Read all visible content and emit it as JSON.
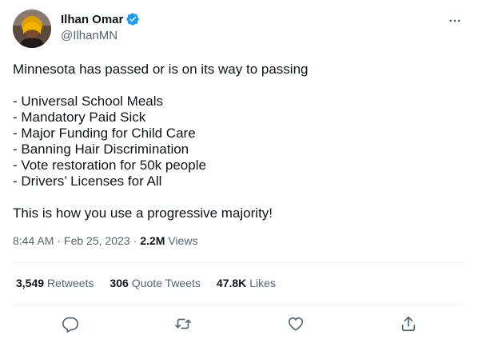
{
  "author": {
    "display_name": "Ilhan Omar",
    "handle": "@IlhanMN",
    "verified": true
  },
  "tweet": {
    "lines": [
      "Minnesota has passed or is on its way to passing",
      "",
      "- Universal School Meals",
      "- Mandatory Paid Sick",
      "- Major Funding for Child Care",
      "- Banning Hair Discrimination",
      "- Vote restoration for 50k people",
      "- Drivers’ Licenses for All",
      "",
      "This is how you use a progressive majority!"
    ],
    "time": "8:44 AM",
    "separator": "·",
    "date": "Feb 25, 2023",
    "views_count": "2.2M",
    "views_label": "Views"
  },
  "stats": {
    "retweets_count": "3,549",
    "retweets_label": "Retweets",
    "quotes_count": "306",
    "quotes_label": "Quote Tweets",
    "likes_count": "47.8K",
    "likes_label": "Likes"
  },
  "icons": {
    "more": "more-horizontal-icon",
    "reply": "reply-icon",
    "retweet": "retweet-icon",
    "like": "heart-icon",
    "share": "share-icon",
    "verified": "verified-badge-icon"
  },
  "colors": {
    "text_primary": "#0f1419",
    "text_secondary": "#536471",
    "verified_blue": "#1d9bf0",
    "divider": "#eff3f4"
  }
}
